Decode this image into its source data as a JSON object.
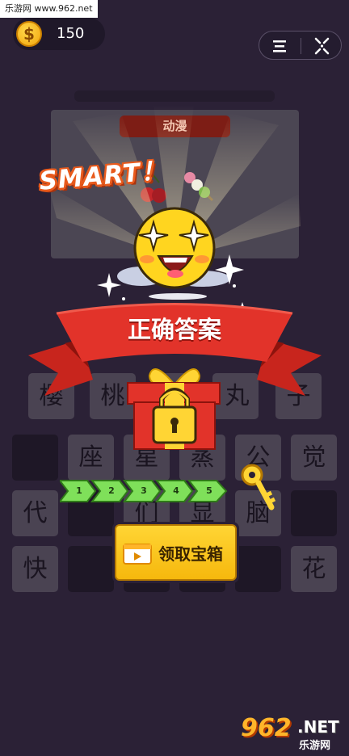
{
  "watermark": {
    "top_text": "乐游网 www.962.net",
    "logo_num": "962",
    "logo_net": ".NET",
    "logo_site": "乐游网"
  },
  "coins": {
    "value": "150",
    "symbol": "$"
  },
  "header": {
    "menu_icon": "menu-icon",
    "close_icon": "close-icon"
  },
  "puzzle": {
    "category": "动漫"
  },
  "celebration": {
    "exclaim": "SMART！",
    "banner_text": "正确答案"
  },
  "answer_row": [
    "樱",
    "桃",
    "",
    "",
    "丸",
    "子"
  ],
  "letter_grid": [
    [
      "",
      "座",
      "星",
      "蒸",
      "公",
      "觉"
    ],
    [
      "代",
      "",
      "们",
      "显",
      "脑",
      ""
    ],
    [
      "快",
      "",
      "",
      "",
      "",
      "花"
    ]
  ],
  "progress": {
    "steps": [
      "1",
      "2",
      "3",
      "4",
      "5"
    ],
    "completed": 5
  },
  "claim_button": {
    "label": "领取宝箱",
    "icon": "video-icon"
  },
  "colors": {
    "background": "#2b2136",
    "ribbon": "#e2332a",
    "button": "#ffd534",
    "progress": "#7fe05a"
  }
}
